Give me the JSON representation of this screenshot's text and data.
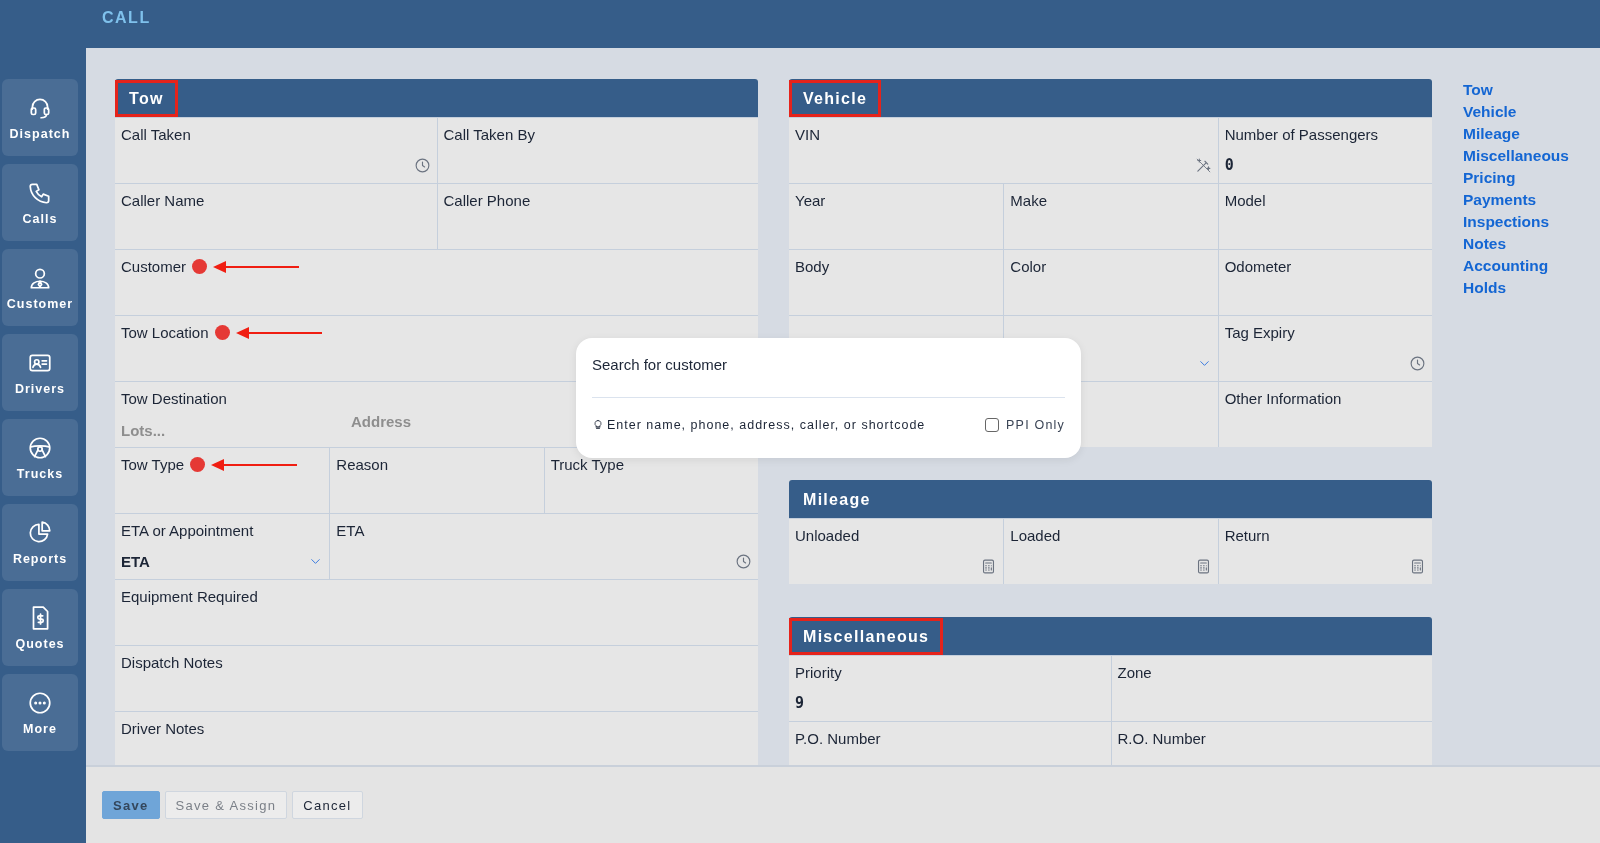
{
  "top_bar": {
    "title": "CALL"
  },
  "sidebar": {
    "items": [
      {
        "label": "Dispatch"
      },
      {
        "label": "Calls"
      },
      {
        "label": "Customer"
      },
      {
        "label": "Drivers"
      },
      {
        "label": "Trucks"
      },
      {
        "label": "Reports"
      },
      {
        "label": "Quotes"
      },
      {
        "label": "More"
      }
    ]
  },
  "tow": {
    "title": "Tow",
    "highlighted": true,
    "rows": [
      {
        "cells": [
          {
            "label": "Call Taken",
            "kind": "time"
          },
          {
            "label": "Call Taken By"
          }
        ]
      },
      {
        "cells": [
          {
            "label": "Caller Name"
          },
          {
            "label": "Caller Phone"
          }
        ]
      },
      {
        "cells": [
          {
            "label": "Customer",
            "annotated": true
          }
        ]
      },
      {
        "cells": [
          {
            "label": "Tow Location",
            "annotated": true
          }
        ]
      },
      {
        "cells": [
          {
            "label": "Tow Destination",
            "inputs": [
              {
                "placeholder": "Lots..."
              },
              {
                "placeholder": "Address"
              }
            ]
          }
        ]
      },
      {
        "cells": [
          {
            "label": "Tow Type",
            "annotated": true
          },
          {
            "label": "Reason"
          },
          {
            "label": "Truck Type"
          }
        ]
      },
      {
        "cells": [
          {
            "label": "ETA or Appointment",
            "value": "ETA",
            "kind": "select"
          },
          {
            "label": "ETA",
            "kind": "time"
          }
        ]
      },
      {
        "cells": [
          {
            "label": "Equipment Required"
          }
        ]
      },
      {
        "cells": [
          {
            "label": "Dispatch Notes"
          }
        ]
      },
      {
        "cells": [
          {
            "label": "Driver Notes"
          }
        ]
      }
    ]
  },
  "vehicle": {
    "title": "Vehicle",
    "highlighted": true,
    "top_row": [
      {
        "label": "VIN",
        "kind": "decode"
      },
      {
        "label": "Number of Passengers",
        "value": "0"
      }
    ],
    "rows": [
      {
        "cells": [
          {
            "label": "Year"
          },
          {
            "label": "Make"
          },
          {
            "label": "Model"
          }
        ]
      },
      {
        "cells": [
          {
            "label": "Body"
          },
          {
            "label": "Color"
          },
          {
            "label": "Odometer"
          }
        ]
      },
      {
        "cells": [
          {},
          {
            "kind": "select"
          },
          {
            "label": "Tag Expiry",
            "kind": "time"
          }
        ]
      },
      {
        "cells": [
          {},
          {},
          {
            "label": "Other Information"
          }
        ]
      }
    ]
  },
  "mileage": {
    "title": "Mileage",
    "highlighted": false,
    "rows": [
      {
        "cells": [
          {
            "label": "Unloaded",
            "kind": "calculated"
          },
          {
            "label": "Loaded",
            "kind": "calculated"
          },
          {
            "label": "Return",
            "kind": "calculated"
          }
        ]
      }
    ]
  },
  "miscellaneous": {
    "title": "Miscellaneous",
    "highlighted": true,
    "rows": [
      {
        "cells": [
          {
            "label": "Priority",
            "value": "9"
          },
          {
            "label": "Zone"
          }
        ]
      },
      {
        "cells": [
          {
            "label": "P.O. Number"
          },
          {
            "label": "R.O. Number"
          }
        ]
      }
    ]
  },
  "section_nav": {
    "items": [
      "Tow",
      "Vehicle",
      "Mileage",
      "Miscellaneous",
      "Pricing",
      "Payments",
      "Inspections",
      "Notes",
      "Accounting",
      "Holds"
    ]
  },
  "customer_search": {
    "title": "Search for customer",
    "hint": "Enter name, phone, address, caller, or shortcode",
    "ppi_only": {
      "label": "PPI Only",
      "checked": false
    }
  },
  "footer": {
    "buttons": [
      {
        "label": "Save",
        "kind": "primary",
        "disabled": true
      },
      {
        "label": "Save & Assign",
        "kind": "secondary",
        "disabled": true
      },
      {
        "label": "Cancel",
        "kind": "secondary",
        "disabled": false
      }
    ]
  }
}
